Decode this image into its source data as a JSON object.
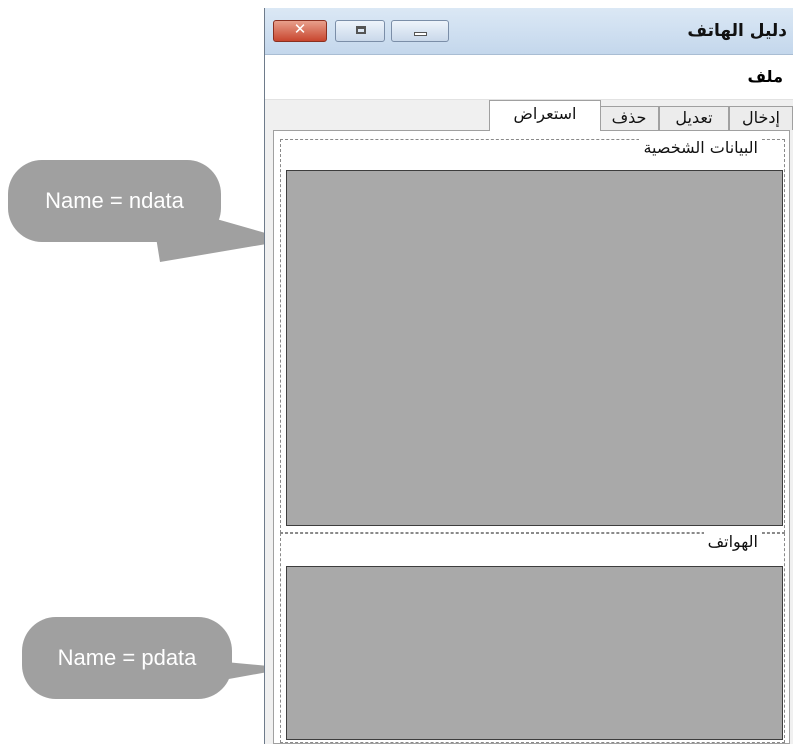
{
  "window": {
    "title": "دليل الهاتف",
    "controls": {
      "close": "✕",
      "maximize": "",
      "minimize": ""
    }
  },
  "menu": {
    "file": "ملف"
  },
  "tabs": [
    {
      "label": "إدخال",
      "active": false
    },
    {
      "label": "تعديل",
      "active": false
    },
    {
      "label": "حذف",
      "active": false
    },
    {
      "label": "استعراض",
      "active": true
    }
  ],
  "groups": {
    "personal": {
      "label": "البيانات الشخصية"
    },
    "phones": {
      "label": "الهواتف"
    }
  },
  "callouts": {
    "ndata": "Name = ndata",
    "pdata": "Name = pdata"
  },
  "colors": {
    "panel": "#a9a9a9",
    "bubble": "#a0a0a0",
    "close_button": "#c8462f"
  }
}
